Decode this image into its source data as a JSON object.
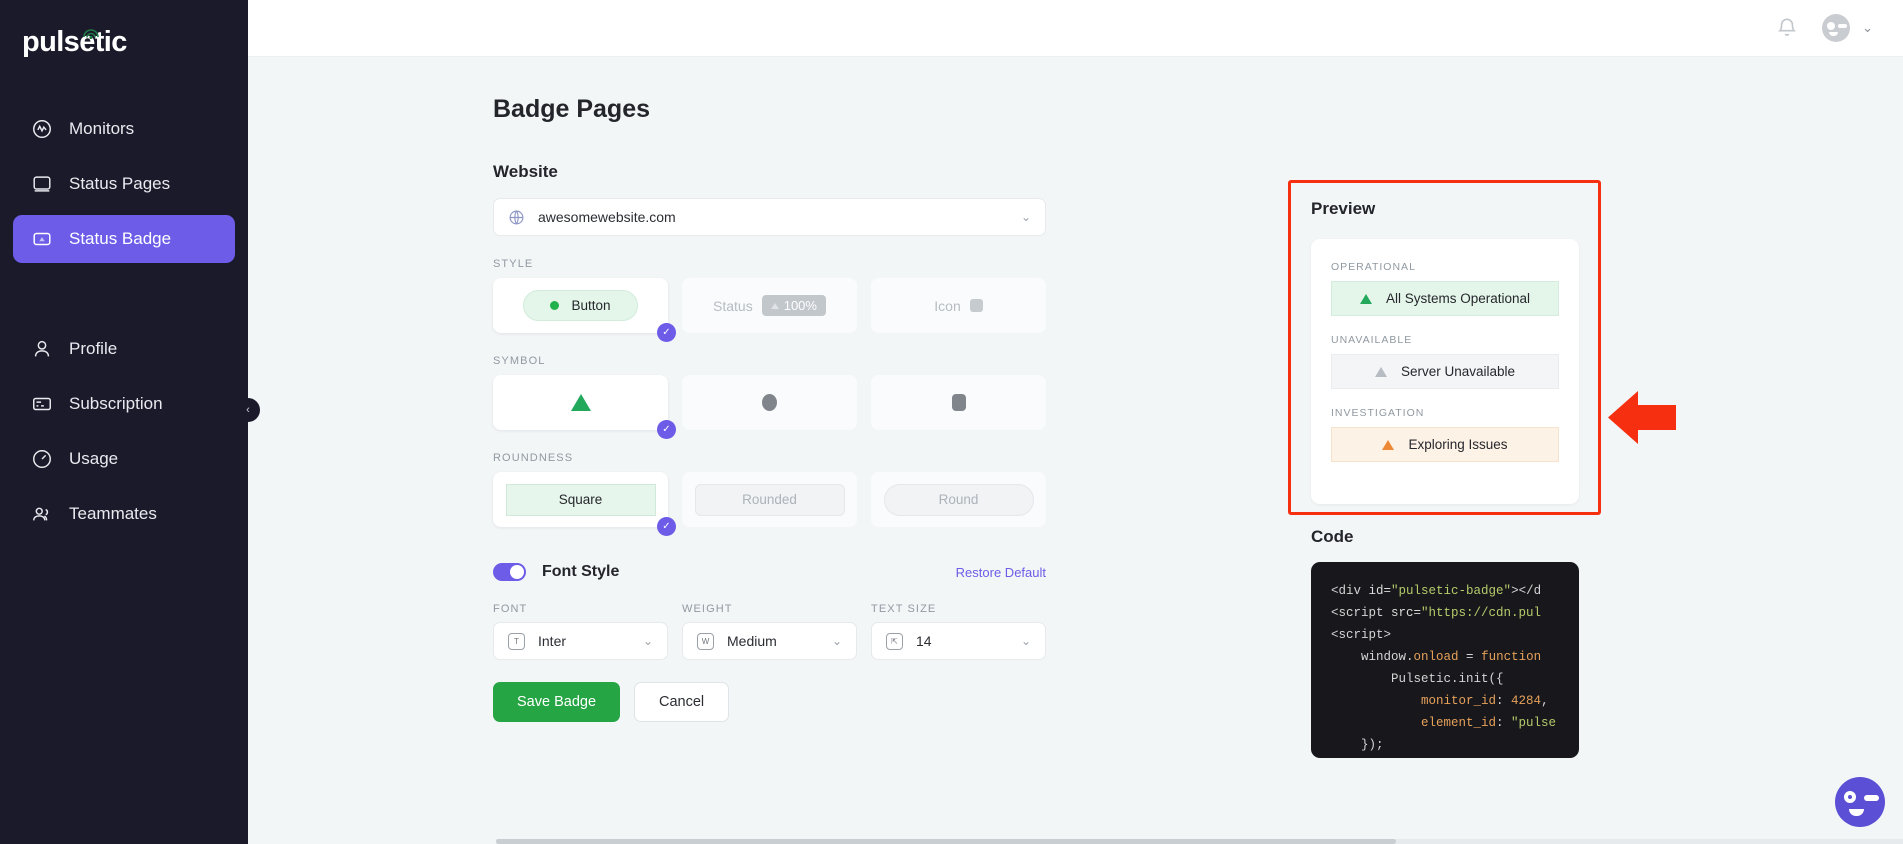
{
  "brand": {
    "name": "pulsetic",
    "accent": "#6c5ce7"
  },
  "sidebar": {
    "items": [
      {
        "label": "Monitors",
        "icon": "monitor-wave-icon",
        "active": false
      },
      {
        "label": "Status Pages",
        "icon": "screen-icon",
        "active": false
      },
      {
        "label": "Status Badge",
        "icon": "badge-icon",
        "active": true
      },
      {
        "label": "Profile",
        "icon": "user-icon",
        "active": false
      },
      {
        "label": "Subscription",
        "icon": "credit-card-icon",
        "active": false
      },
      {
        "label": "Usage",
        "icon": "gauge-icon",
        "active": false
      },
      {
        "label": "Teammates",
        "icon": "users-icon",
        "active": false
      }
    ],
    "collapse_label": "‹"
  },
  "topbar": {
    "notification_icon": "bell-icon",
    "avatar_icon": "avatar-icon",
    "caret": "⌄"
  },
  "page": {
    "title": "Badge Pages"
  },
  "website": {
    "section_label": "Website",
    "selected": "awesomewebsite.com",
    "icon": "globe-icon",
    "chevron": "⌄"
  },
  "style": {
    "label": "STYLE",
    "options": [
      {
        "id": "button",
        "label": "Button",
        "selected": true
      },
      {
        "id": "status",
        "label": "Status",
        "value": "100%",
        "selected": false
      },
      {
        "id": "icon",
        "label": "Icon",
        "selected": false
      }
    ]
  },
  "symbol": {
    "label": "SYMBOL",
    "options": [
      {
        "id": "triangle",
        "shape": "triangle",
        "selected": true
      },
      {
        "id": "circle",
        "shape": "circle",
        "selected": false
      },
      {
        "id": "square",
        "shape": "square",
        "selected": false
      }
    ]
  },
  "roundness": {
    "label": "ROUNDNESS",
    "options": [
      {
        "id": "square",
        "label": "Square",
        "selected": true
      },
      {
        "id": "rounded",
        "label": "Rounded",
        "selected": false
      },
      {
        "id": "round",
        "label": "Round",
        "selected": false
      }
    ]
  },
  "font_style": {
    "toggle_label": "Font Style",
    "toggle_on": true,
    "restore_label": "Restore Default",
    "fields": [
      {
        "label": "FONT",
        "value": "Inter",
        "icon": "text-icon"
      },
      {
        "label": "WEIGHT",
        "value": "Medium",
        "icon": "weight-icon"
      },
      {
        "label": "TEXT SIZE",
        "value": "14",
        "icon": "size-icon"
      }
    ]
  },
  "actions": {
    "save": "Save Badge",
    "cancel": "Cancel"
  },
  "preview": {
    "heading": "Preview",
    "items": [
      {
        "label": "OPERATIONAL",
        "badge": "All Systems Operational",
        "state": "ok"
      },
      {
        "label": "UNAVAILABLE",
        "badge": "Server Unavailable",
        "state": "un"
      },
      {
        "label": "INVESTIGATION",
        "badge": "Exploring Issues",
        "state": "inv"
      }
    ],
    "highlight_color": "#f52f10"
  },
  "code": {
    "heading": "Code",
    "lines": [
      "<div id=\"pulsetic-badge\"></d",
      "<script src=\"https://cdn.pul",
      "<script>",
      "    window.onload = function",
      "        Pulsetic.init({",
      "            monitor_id: 4284,",
      "            element_id: \"pulse",
      "    });",
      "    }"
    ],
    "monitor_id": "4284",
    "element_id": "pulse"
  },
  "chat": {
    "icon": "chat-avatar-icon"
  }
}
